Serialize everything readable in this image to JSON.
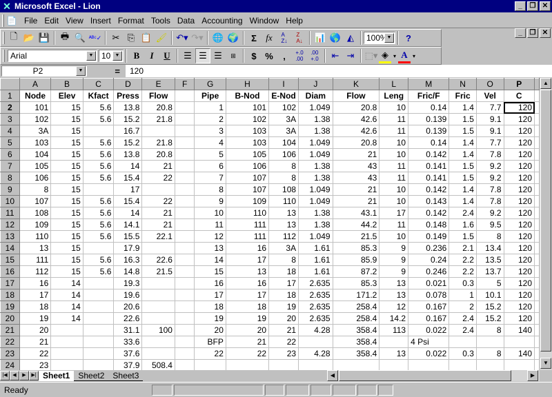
{
  "window": {
    "title": "Microsoft Excel - Lion",
    "app_icon": "excel-icon",
    "controls": [
      "minimize",
      "restore",
      "close"
    ]
  },
  "menu": {
    "items": [
      "File",
      "Edit",
      "View",
      "Insert",
      "Format",
      "Tools",
      "Data",
      "Accounting",
      "Window",
      "Help"
    ]
  },
  "standard_toolbar": {
    "buttons": [
      "new-icon",
      "open-icon",
      "save-icon",
      "print-icon",
      "print-preview-icon",
      "spelling-icon",
      "cut-icon",
      "copy-icon",
      "paste-icon",
      "format-painter-icon",
      "undo-icon",
      "redo-icon",
      "web-icon",
      "web-toolbar-icon",
      "autosum-icon",
      "function-icon",
      "sort-ascending-icon",
      "sort-descending-icon",
      "chart-wizard-icon",
      "map-icon",
      "drawing-icon",
      "help-icon"
    ],
    "zoom": "100%"
  },
  "formatting_toolbar": {
    "font": "Arial",
    "font_size": "10",
    "buttons": [
      "bold-icon",
      "italic-icon",
      "underline-icon",
      "align-left-icon",
      "align-center-icon",
      "align-right-icon",
      "merge-center-icon",
      "currency-icon",
      "percent-icon",
      "comma-icon",
      "increase-decimal-icon",
      "decrease-decimal-icon",
      "decrease-indent-icon",
      "increase-indent-icon",
      "borders-icon",
      "fill-color-icon",
      "font-color-icon"
    ],
    "fill_color": "#ffff00",
    "font_color": "#ff0000"
  },
  "formula_bar": {
    "name_box": "P2",
    "equals": "=",
    "value": "120"
  },
  "sheet": {
    "columns": [
      "A",
      "B",
      "C",
      "D",
      "E",
      "F",
      "G",
      "H",
      "I",
      "J",
      "K",
      "L",
      "M",
      "N",
      "O",
      "P"
    ],
    "active_cell": "P2",
    "rows": [
      {
        "n": "1",
        "cells": [
          "Node",
          "Elev",
          "Kfact",
          "Press",
          "Flow",
          "",
          "Pipe",
          "B-Nod",
          "E-Nod",
          "Diam",
          "Flow",
          "Leng",
          "Fric/F",
          "Fric",
          "Vel",
          "C"
        ]
      },
      {
        "n": "2",
        "cells": [
          "101",
          "15",
          "5.6",
          "13.8",
          "20.8",
          "",
          "1",
          "101",
          "102",
          "1.049",
          "20.8",
          "10",
          "0.14",
          "1.4",
          "7.7",
          "120"
        ]
      },
      {
        "n": "3",
        "cells": [
          "102",
          "15",
          "5.6",
          "15.2",
          "21.8",
          "",
          "2",
          "102",
          "3A",
          "1.38",
          "42.6",
          "11",
          "0.139",
          "1.5",
          "9.1",
          "120"
        ]
      },
      {
        "n": "4",
        "cells": [
          "3A",
          "15",
          "",
          "16.7",
          "",
          "",
          "3",
          "103",
          "3A",
          "1.38",
          "42.6",
          "11",
          "0.139",
          "1.5",
          "9.1",
          "120"
        ]
      },
      {
        "n": "5",
        "cells": [
          "103",
          "15",
          "5.6",
          "15.2",
          "21.8",
          "",
          "4",
          "103",
          "104",
          "1.049",
          "20.8",
          "10",
          "0.14",
          "1.4",
          "7.7",
          "120"
        ]
      },
      {
        "n": "6",
        "cells": [
          "104",
          "15",
          "5.6",
          "13.8",
          "20.8",
          "",
          "5",
          "105",
          "106",
          "1.049",
          "21",
          "10",
          "0.142",
          "1.4",
          "7.8",
          "120"
        ]
      },
      {
        "n": "7",
        "cells": [
          "105",
          "15",
          "5.6",
          "14",
          "21",
          "",
          "6",
          "106",
          "8",
          "1.38",
          "43",
          "11",
          "0.141",
          "1.5",
          "9.2",
          "120"
        ]
      },
      {
        "n": "8",
        "cells": [
          "106",
          "15",
          "5.6",
          "15.4",
          "22",
          "",
          "7",
          "107",
          "8",
          "1.38",
          "43",
          "11",
          "0.141",
          "1.5",
          "9.2",
          "120"
        ]
      },
      {
        "n": "9",
        "cells": [
          "8",
          "15",
          "",
          "17",
          "",
          "",
          "8",
          "107",
          "108",
          "1.049",
          "21",
          "10",
          "0.142",
          "1.4",
          "7.8",
          "120"
        ]
      },
      {
        "n": "10",
        "cells": [
          "107",
          "15",
          "5.6",
          "15.4",
          "22",
          "",
          "9",
          "109",
          "110",
          "1.049",
          "21",
          "10",
          "0.143",
          "1.4",
          "7.8",
          "120"
        ]
      },
      {
        "n": "11",
        "cells": [
          "108",
          "15",
          "5.6",
          "14",
          "21",
          "",
          "10",
          "110",
          "13",
          "1.38",
          "43.1",
          "17",
          "0.142",
          "2.4",
          "9.2",
          "120"
        ]
      },
      {
        "n": "12",
        "cells": [
          "109",
          "15",
          "5.6",
          "14.1",
          "21",
          "",
          "11",
          "111",
          "13",
          "1.38",
          "44.2",
          "11",
          "0.148",
          "1.6",
          "9.5",
          "120"
        ]
      },
      {
        "n": "13",
        "cells": [
          "110",
          "15",
          "5.6",
          "15.5",
          "22.1",
          "",
          "12",
          "111",
          "112",
          "1.049",
          "21.5",
          "10",
          "0.149",
          "1.5",
          "8",
          "120"
        ]
      },
      {
        "n": "14",
        "cells": [
          "13",
          "15",
          "",
          "17.9",
          "",
          "",
          "13",
          "16",
          "3A",
          "1.61",
          "85.3",
          "9",
          "0.236",
          "2.1",
          "13.4",
          "120"
        ]
      },
      {
        "n": "15",
        "cells": [
          "111",
          "15",
          "5.6",
          "16.3",
          "22.6",
          "",
          "14",
          "17",
          "8",
          "1.61",
          "85.9",
          "9",
          "0.24",
          "2.2",
          "13.5",
          "120"
        ]
      },
      {
        "n": "16",
        "cells": [
          "112",
          "15",
          "5.6",
          "14.8",
          "21.5",
          "",
          "15",
          "13",
          "18",
          "1.61",
          "87.2",
          "9",
          "0.246",
          "2.2",
          "13.7",
          "120"
        ]
      },
      {
        "n": "17",
        "cells": [
          "16",
          "14",
          "",
          "19.3",
          "",
          "",
          "16",
          "16",
          "17",
          "2.635",
          "85.3",
          "13",
          "0.021",
          "0.3",
          "5",
          "120"
        ]
      },
      {
        "n": "18",
        "cells": [
          "17",
          "14",
          "",
          "19.6",
          "",
          "",
          "17",
          "17",
          "18",
          "2.635",
          "171.2",
          "13",
          "0.078",
          "1",
          "10.1",
          "120"
        ]
      },
      {
        "n": "19",
        "cells": [
          "18",
          "14",
          "",
          "20.6",
          "",
          "",
          "18",
          "18",
          "19",
          "2.635",
          "258.4",
          "12",
          "0.167",
          "2",
          "15.2",
          "120"
        ]
      },
      {
        "n": "20",
        "cells": [
          "19",
          "14",
          "",
          "22.6",
          "",
          "",
          "19",
          "19",
          "20",
          "2.635",
          "258.4",
          "14.2",
          "0.167",
          "2.4",
          "15.2",
          "120"
        ]
      },
      {
        "n": "21",
        "cells": [
          "20",
          "",
          "",
          "31.1",
          "100",
          "",
          "20",
          "20",
          "21",
          "4.28",
          "358.4",
          "113",
          "0.022",
          "2.4",
          "8",
          "140"
        ]
      },
      {
        "n": "22",
        "cells": [
          "21",
          "",
          "",
          "33.6",
          "",
          "",
          "BFP",
          "21",
          "22",
          "",
          "358.4",
          "",
          "4  Psi",
          "",
          "",
          ""
        ]
      },
      {
        "n": "23",
        "cells": [
          "22",
          "",
          "",
          "37.6",
          "",
          "",
          "22",
          "22",
          "23",
          "4.28",
          "358.4",
          "13",
          "0.022",
          "0.3",
          "8",
          "140"
        ]
      },
      {
        "n": "24",
        "cells": [
          "23",
          "",
          "",
          "37.9",
          "508.4",
          "",
          "",
          "",
          "",
          "",
          "",
          "",
          "",
          "",
          "",
          ""
        ]
      }
    ]
  },
  "sheet_tabs": {
    "tabs": [
      "Sheet1",
      "Sheet2",
      "Sheet3"
    ],
    "active": "Sheet1"
  },
  "status_bar": {
    "text": "Ready"
  }
}
